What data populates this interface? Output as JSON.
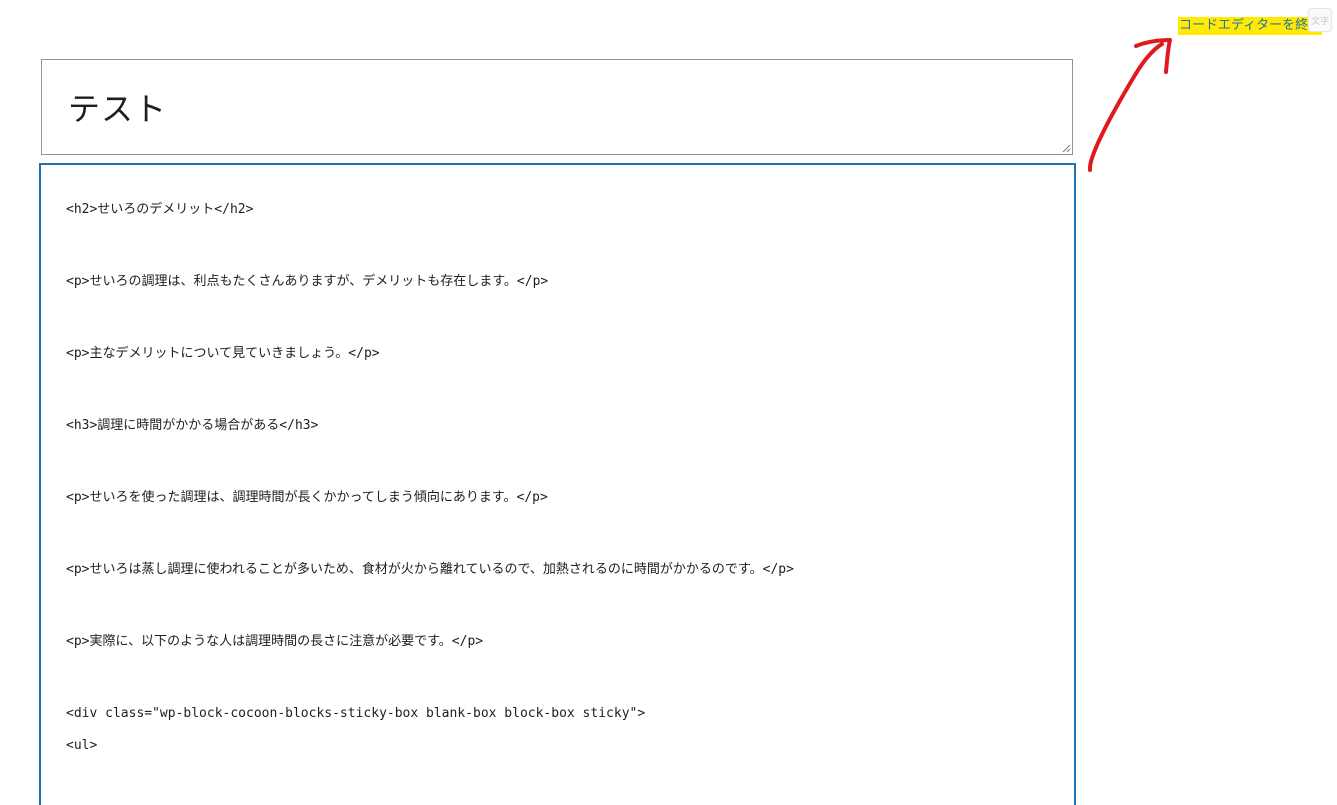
{
  "header": {
    "exit_code_editor_label": "コードエディターを終了",
    "corner_badge_text": "文字"
  },
  "post": {
    "title": "テスト"
  },
  "code_editor": {
    "lines": [
      "<h2>せいろのデメリット</h2>",
      "<p>せいろの調理は、利点もたくさんありますが、デメリットも存在します。</p>",
      "<p>主なデメリットについて見ていきましょう。</p>",
      "<h3>調理に時間がかかる場合がある</h3>",
      "<p>せいろを使った調理は、調理時間が長くかかってしまう傾向にあります。</p>",
      "<p>せいろは蒸し調理に使われることが多いため、食材が火から離れているので、加熱されるのに時間がかかるのです。</p>",
      "<p>実際に、以下のような人は調理時間の長さに注意が必要です。</p>",
      "<div class=\"wp-block-cocoon-blocks-sticky-box blank-box block-box sticky\">",
      "<ul>"
    ]
  },
  "colors": {
    "accent": "#2271b1",
    "highlight": "#ffea00",
    "annotation": "#e0191f"
  }
}
